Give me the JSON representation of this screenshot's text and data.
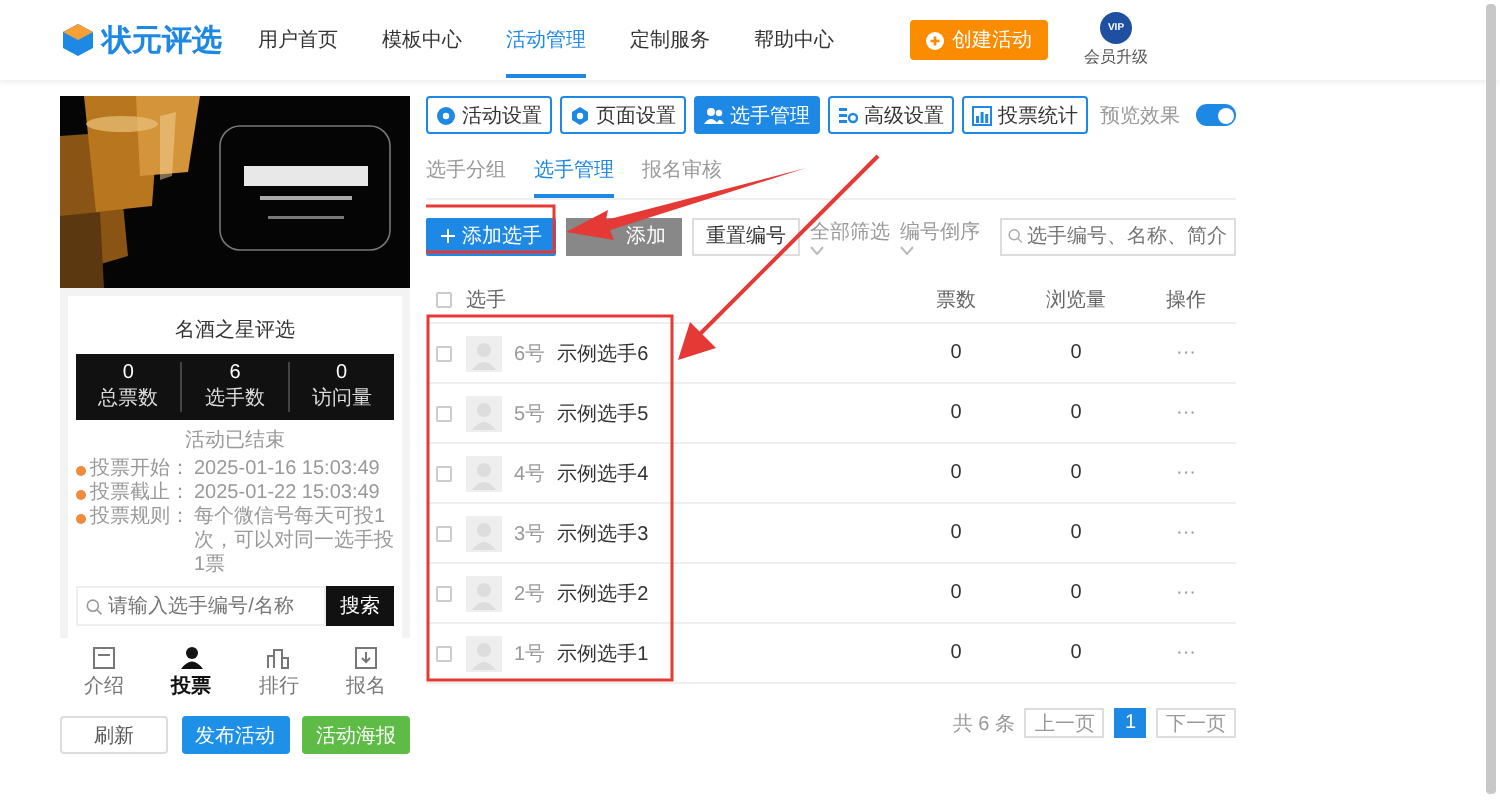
{
  "brand": {
    "name": "状元评选"
  },
  "nav": [
    {
      "label": "用户首页",
      "selected": false
    },
    {
      "label": "模板中心",
      "selected": false
    },
    {
      "label": "活动管理",
      "selected": true
    },
    {
      "label": "定制服务",
      "selected": false
    },
    {
      "label": "帮助中心",
      "selected": false
    }
  ],
  "create_button": "创建活动",
  "vip": {
    "badge": "VIP",
    "label": "会员升级"
  },
  "preview": {
    "title": "名酒之星评选",
    "stats": [
      {
        "value": "0",
        "label": "总票数"
      },
      {
        "value": "6",
        "label": "选手数"
      },
      {
        "value": "0",
        "label": "访问量"
      }
    ],
    "status": "活动已结束",
    "info": [
      {
        "label": "投票开始：",
        "value": "2025-01-16 15:03:49"
      },
      {
        "label": "投票截止：",
        "value": "2025-01-22 15:03:49"
      },
      {
        "label": "投票规则：",
        "value": "每个微信号每天可投1次，可以对同一选手投1票"
      }
    ],
    "search": {
      "placeholder": "请输入选手编号/名称",
      "button": "搜索"
    },
    "tabbar": [
      {
        "label": "介绍",
        "selected": false
      },
      {
        "label": "投票",
        "selected": true
      },
      {
        "label": "排行",
        "selected": false
      },
      {
        "label": "报名",
        "selected": false
      }
    ]
  },
  "footer_buttons": [
    {
      "label": "刷新",
      "kind": "plain"
    },
    {
      "label": "发布活动",
      "kind": "primary"
    },
    {
      "label": "活动海报",
      "kind": "success"
    }
  ],
  "tool_tabs": [
    {
      "label": "活动设置",
      "selected": false
    },
    {
      "label": "页面设置",
      "selected": false
    },
    {
      "label": "选手管理",
      "selected": true
    },
    {
      "label": "高级设置",
      "selected": false
    },
    {
      "label": "投票统计",
      "selected": false
    }
  ],
  "preview_toggle": {
    "label": "预览效果",
    "on": true
  },
  "sub_tabs": [
    {
      "label": "选手分组",
      "selected": false
    },
    {
      "label": "选手管理",
      "selected": true
    },
    {
      "label": "报名审核",
      "selected": false
    }
  ],
  "toolbar": {
    "add": "添加选手",
    "batch": "添加",
    "reset": "重置编号",
    "filter": "全部筛选",
    "sort": "编号倒序",
    "search_placeholder": "选手编号、名称、简介"
  },
  "table": {
    "header_checked": false,
    "columns": [
      "选手",
      "票数",
      "浏览量",
      "操作"
    ],
    "rows": [
      {
        "number": "6号",
        "name": "示例选手6",
        "votes": "0",
        "views": "0",
        "action": "···",
        "checked": false
      },
      {
        "number": "5号",
        "name": "示例选手5",
        "votes": "0",
        "views": "0",
        "action": "···",
        "checked": false
      },
      {
        "number": "4号",
        "name": "示例选手4",
        "votes": "0",
        "views": "0",
        "action": "···",
        "checked": false
      },
      {
        "number": "3号",
        "name": "示例选手3",
        "votes": "0",
        "views": "0",
        "action": "···",
        "checked": false
      },
      {
        "number": "2号",
        "name": "示例选手2",
        "votes": "0",
        "views": "0",
        "action": "···",
        "checked": false
      },
      {
        "number": "1号",
        "name": "示例选手1",
        "votes": "0",
        "views": "0",
        "action": "···",
        "checked": false
      }
    ]
  },
  "pagination": {
    "total": "共 6 条",
    "prev": "上一页",
    "pages": [
      {
        "label": "1",
        "selected": true
      }
    ],
    "next": "下一页"
  }
}
